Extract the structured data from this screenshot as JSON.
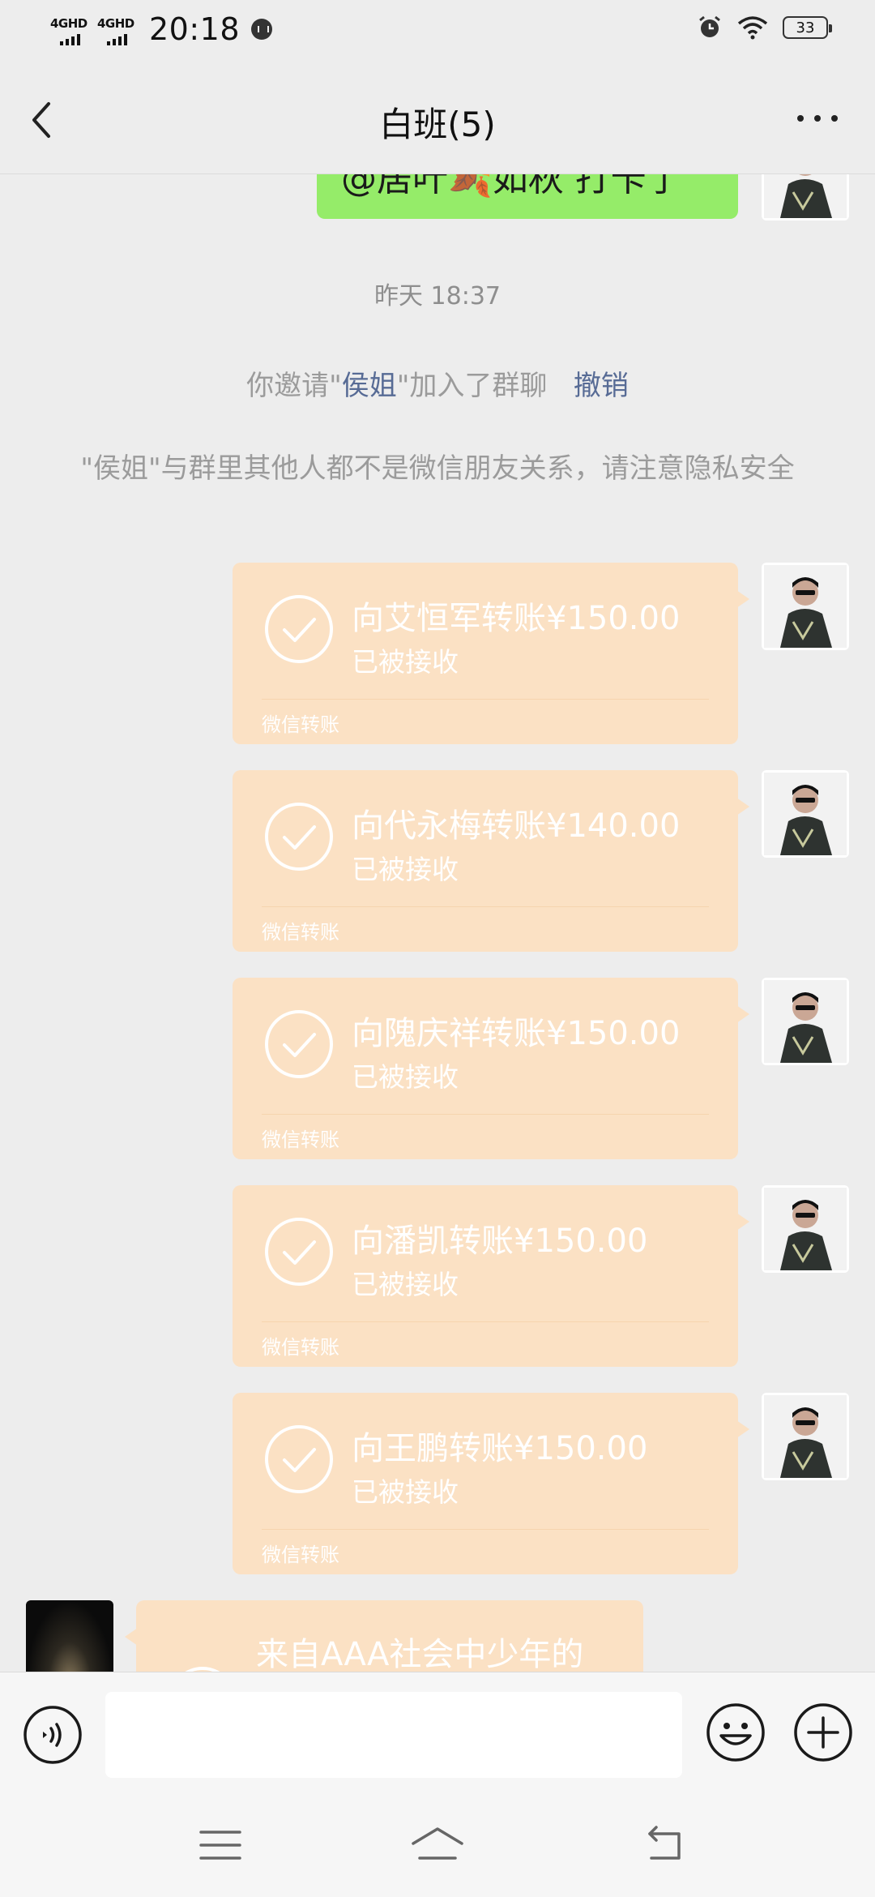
{
  "status_bar": {
    "signal1": "4GHD",
    "signal2": "4GHD",
    "time": "20:18",
    "battery": "33"
  },
  "nav": {
    "title": "白班(5)"
  },
  "messages": {
    "partial_green_text": "@居叶🍂如秋 打卡了",
    "timestamp": "昨天 18:37",
    "invite_prefix": "你邀请\"",
    "invite_name": "侯姐",
    "invite_suffix": "\"加入了群聊",
    "invite_revoke": "撤销",
    "privacy_notice": "\"侯姐\"与群里其他人都不是微信朋友关系，请注意隐私安全",
    "transfers": [
      {
        "title": "向艾恒军转账¥150.00",
        "status": "已被接收",
        "footer": "微信转账"
      },
      {
        "title": "向代永梅转账¥140.00",
        "status": "已被接收",
        "footer": "微信转账"
      },
      {
        "title": "向隗庆祥转账¥150.00",
        "status": "已被接收",
        "footer": "微信转账"
      },
      {
        "title": "向潘凯转账¥150.00",
        "status": "已被接收",
        "footer": "微信转账"
      },
      {
        "title": "向王鹏转账¥150.00",
        "status": "已被接收",
        "footer": "微信转账"
      }
    ],
    "incoming_partial_title": "来自AAA社会中少年的"
  },
  "icons": {
    "back": "chevron-left-icon",
    "more": "more-dots-icon",
    "voice": "voice-icon",
    "emoji": "emoji-icon",
    "plus": "plus-icon",
    "transfer_done": "check-circle-icon"
  },
  "colors": {
    "background": "#ededed",
    "transfer_bubble": "#fbe1c4",
    "own_message": "#95ec69",
    "link": "#576b95"
  }
}
